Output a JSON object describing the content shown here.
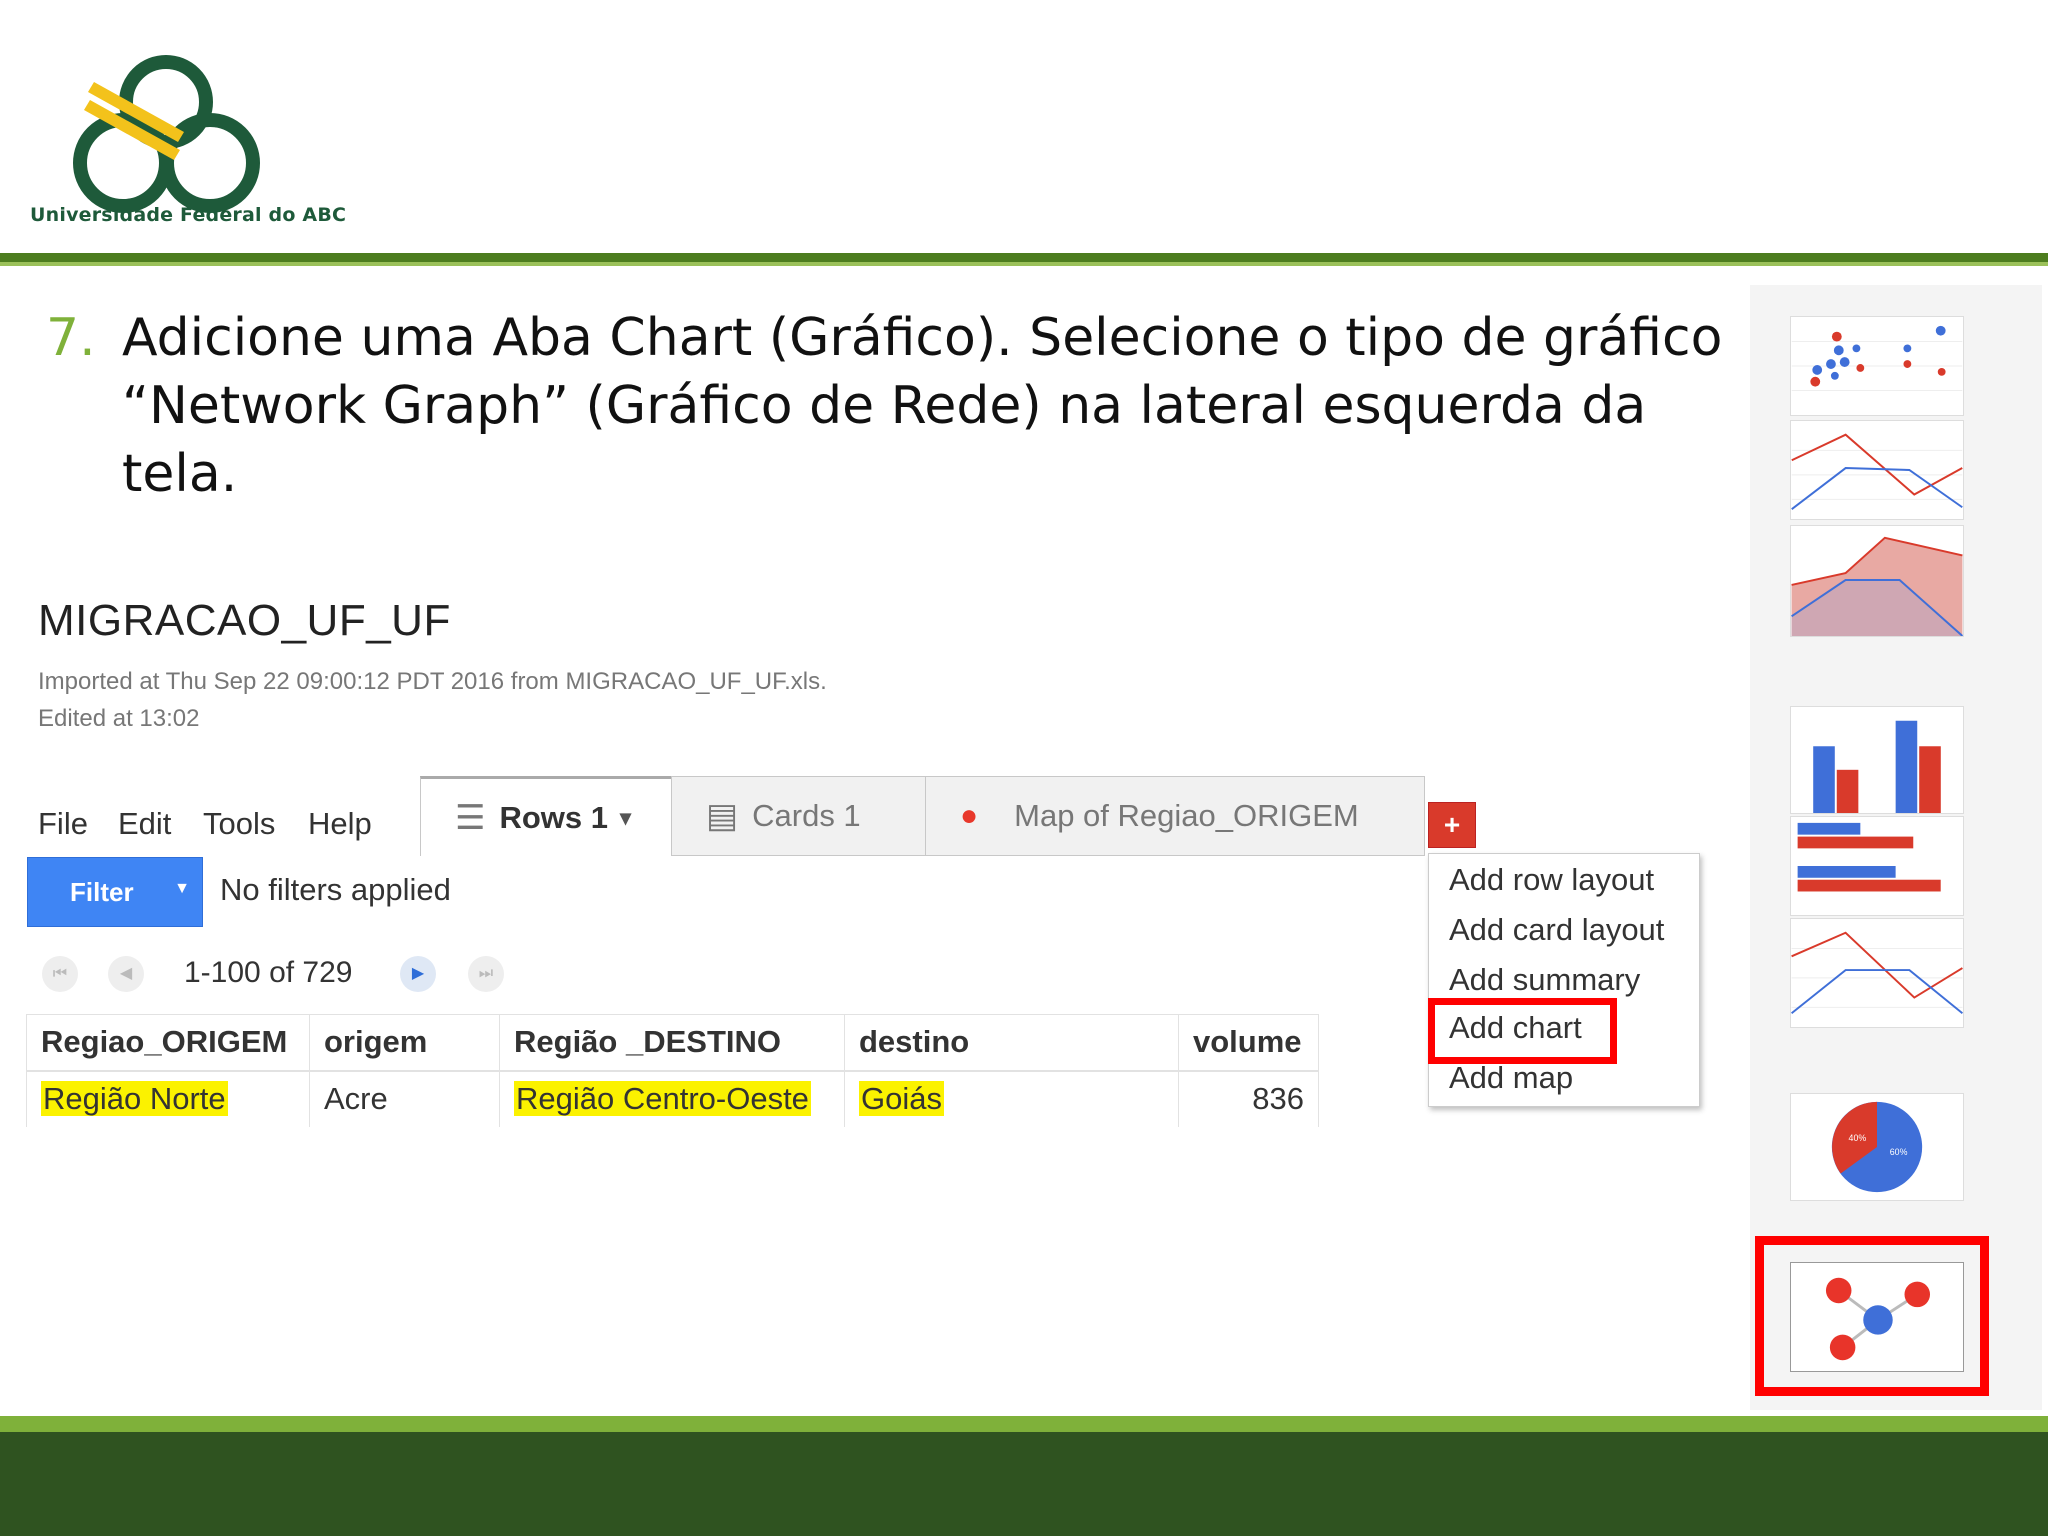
{
  "slide": {
    "logo_caption": "Universidade Federal do ABC",
    "step_number": "7.",
    "step_text": "Adicione uma Aba Chart (Gráfico). Selecione o tipo de gráfico “Network Graph” (Gráfico de Rede) na lateral esquerda da tela."
  },
  "table_page": {
    "title": "MIGRACAO_UF_UF",
    "imported": "Imported at Thu Sep 22 09:00:12 PDT 2016 from MIGRACAO_UF_UF.xls.",
    "edited": "Edited at 13:02",
    "menu": [
      "File",
      "Edit",
      "Tools",
      "Help"
    ],
    "tabs": {
      "rows": "Rows 1",
      "cards": "Cards 1",
      "map": "Map of Regiao_ORIGEM"
    },
    "add_tab_symbol": "+",
    "filter_label": "Filter",
    "filter_status": "No filters applied",
    "pager_range": "1-100 of 729",
    "columns": [
      "Regiao_ORIGEM",
      "origem",
      "Região _DESTINO",
      "destino",
      "volume"
    ],
    "rows": [
      {
        "regiao_origem": "Região Norte",
        "origem": "Acre",
        "regiao_destino": "Região Centro-Oeste",
        "destino": "Goiás",
        "volume": "836"
      }
    ],
    "add_menu": [
      "Add row layout",
      "Add card layout",
      "Add summary",
      "Add chart",
      "Add map"
    ],
    "selected_menu_item": "Add chart"
  },
  "chart_types": {
    "items": [
      "scatter-chart-icon",
      "line-chart-icon",
      "area-chart-icon",
      "column-chart-icon",
      "bar-chart-icon",
      "line-chart-icon",
      "pie-chart-icon",
      "network-graph-icon"
    ],
    "selected": "network-graph-icon",
    "pie_labels": [
      "40%",
      "60%"
    ]
  },
  "colors": {
    "brand_green": "#2f5320",
    "accent_green": "#7fb13a",
    "series_red": "#d93a2b",
    "series_blue": "#3f6fd8",
    "highlight_yellow": "#fbf200",
    "callout_red": "#ff0000"
  }
}
